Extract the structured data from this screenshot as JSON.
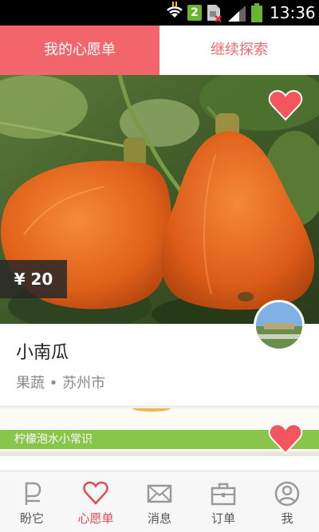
{
  "status_bar": {
    "badge": "2",
    "time": "13:36"
  },
  "tabs": [
    {
      "label": "我的心愿单",
      "active": true
    },
    {
      "label": "继续探索",
      "active": false
    }
  ],
  "card1": {
    "price": "¥ 20",
    "title": "小南瓜",
    "subtitle": "果蔬 • 苏州市"
  },
  "card2": {
    "tip": "柠檬泡水小常识"
  },
  "bottom_nav": [
    {
      "label": "盼它",
      "icon": "pan-ta-icon"
    },
    {
      "label": "心愿单",
      "icon": "heart-outline-icon",
      "active": true
    },
    {
      "label": "消息",
      "icon": "envelope-icon"
    },
    {
      "label": "订单",
      "icon": "briefcase-icon"
    },
    {
      "label": "我",
      "icon": "user-icon"
    }
  ],
  "colors": {
    "accent": "#f2666b",
    "tip_green": "#88c54b",
    "status_bar": "#000000"
  }
}
